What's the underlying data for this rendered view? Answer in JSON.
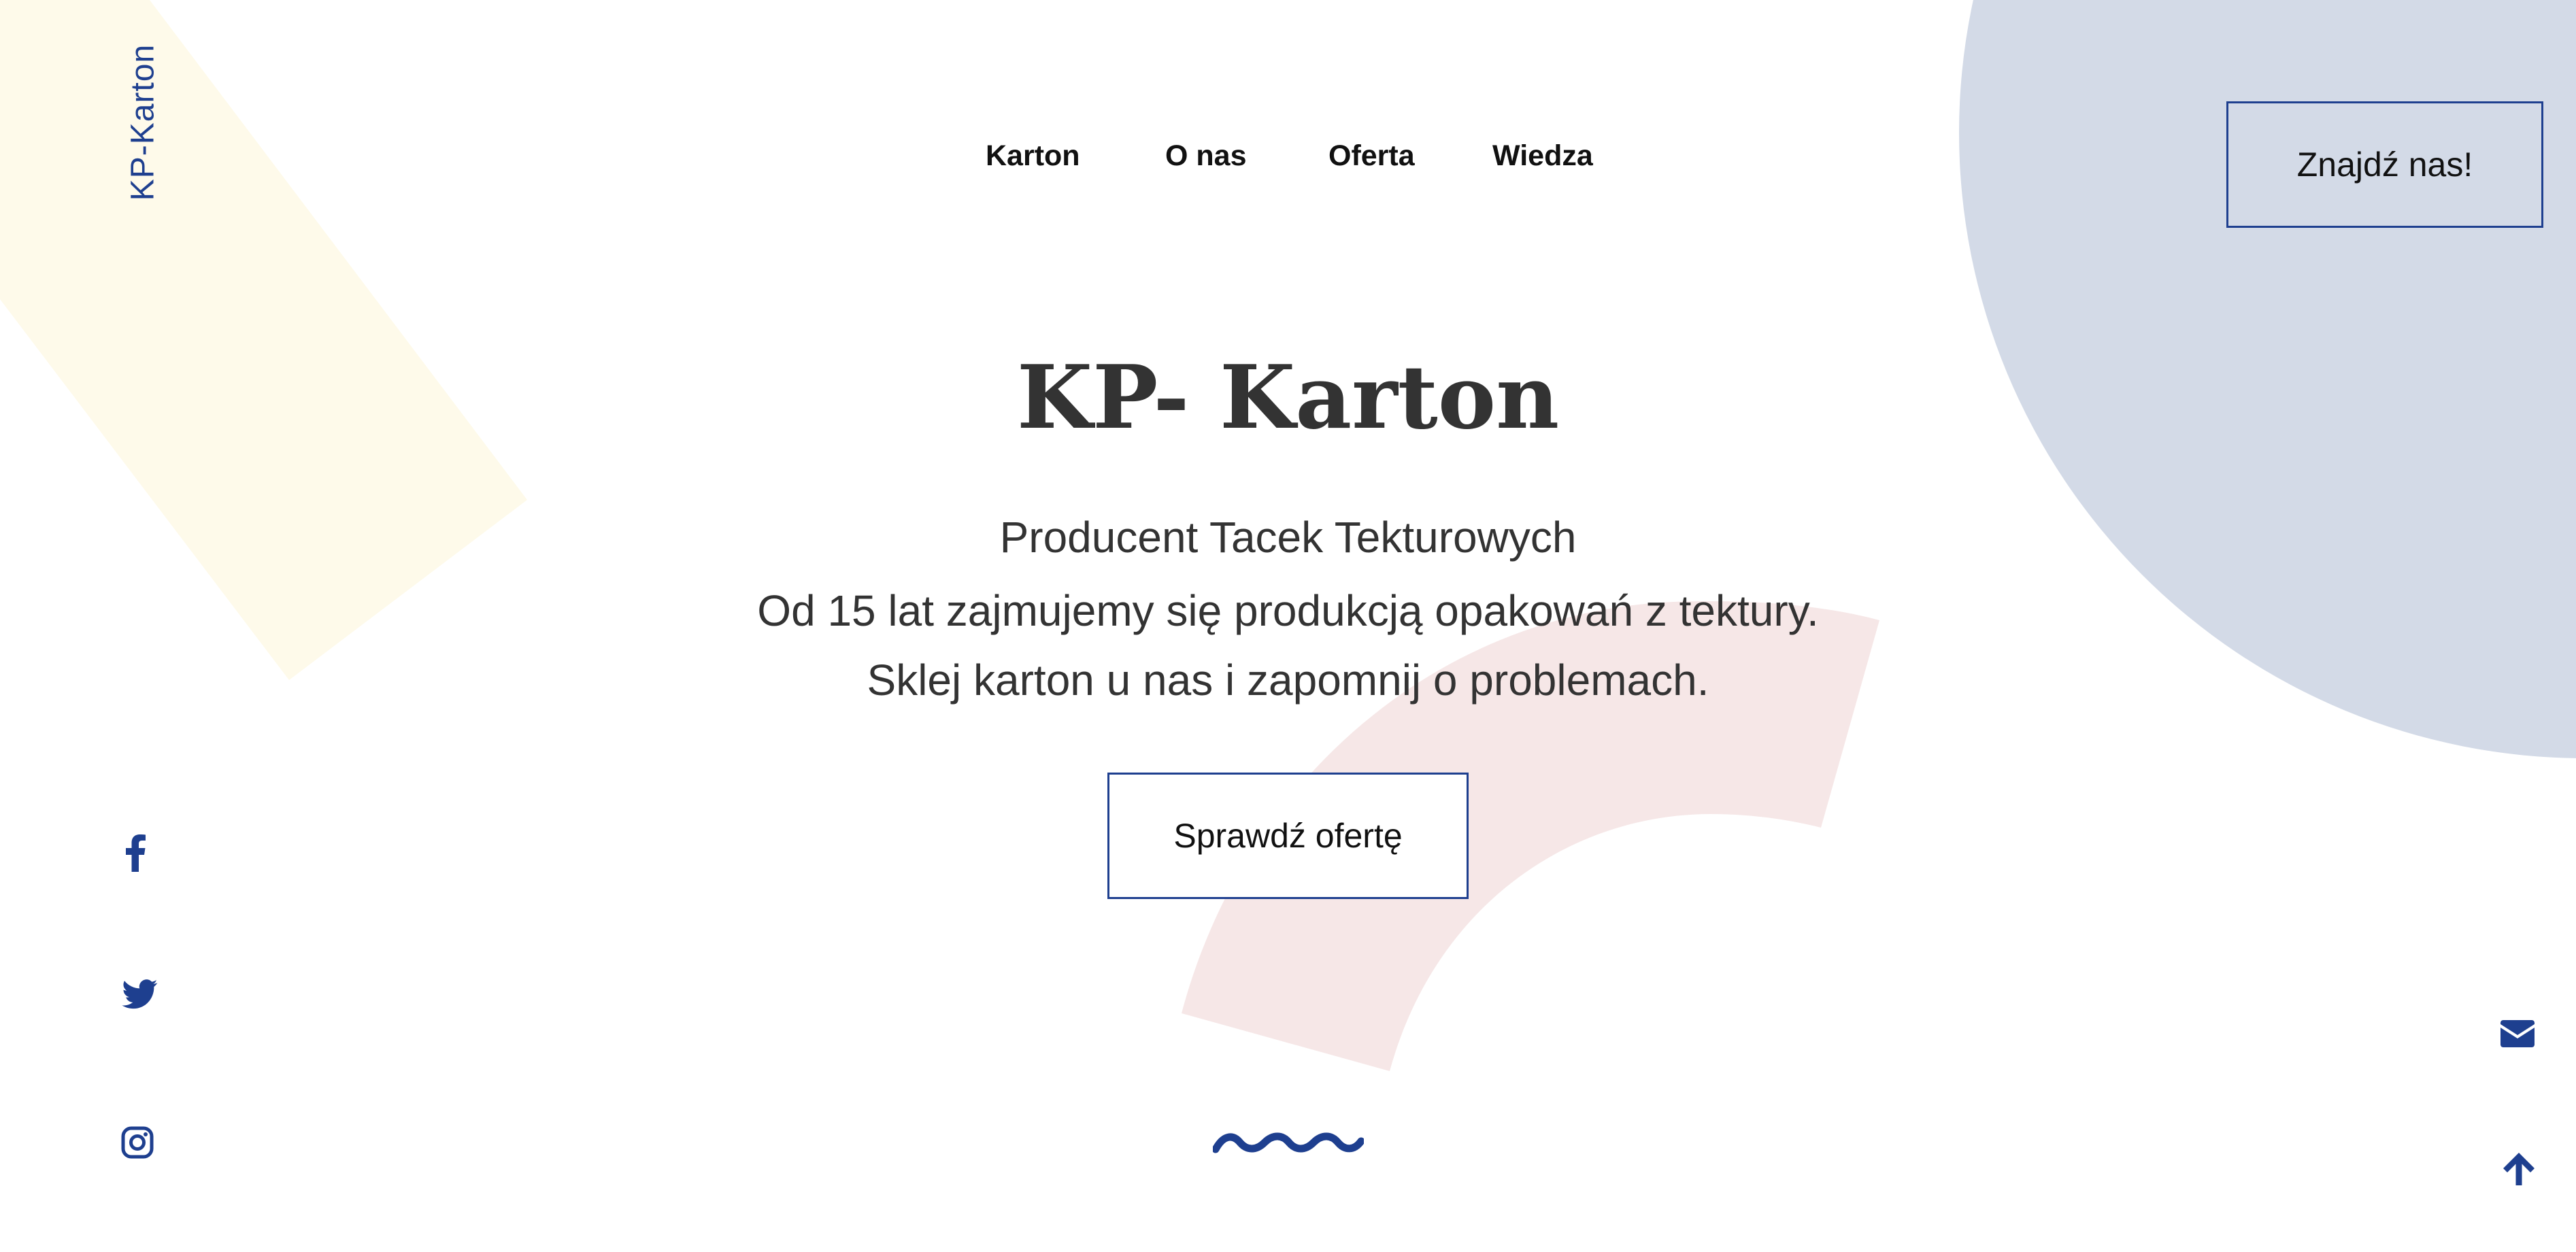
{
  "brand": {
    "side_logo": "KP-Karton"
  },
  "nav": {
    "items": [
      {
        "label": "Karton"
      },
      {
        "label": "O nas"
      },
      {
        "label": "Oferta"
      },
      {
        "label": "Wiedza"
      }
    ]
  },
  "header": {
    "find_us_label": "Znajdź nas!"
  },
  "hero": {
    "title": "KP- Karton",
    "lines": [
      "Producent Tacek Tekturowych",
      "Od 15 lat zajmujemy się produkcją opakowań z tektury.",
      "Sklej karton u nas i zapomnij o problemach."
    ],
    "cta_label": "Sprawdź ofertę"
  },
  "social": {
    "icons": [
      "facebook-icon",
      "twitter-icon",
      "instagram-icon"
    ]
  },
  "utility": {
    "icons": [
      "mail-icon",
      "arrow-up-icon"
    ]
  },
  "colors": {
    "accent": "#1e3f8f",
    "circle": "#d3dae7",
    "yellow_band": "#fefaea",
    "pink_arc": "#f6e7e7",
    "text": "#333333"
  }
}
